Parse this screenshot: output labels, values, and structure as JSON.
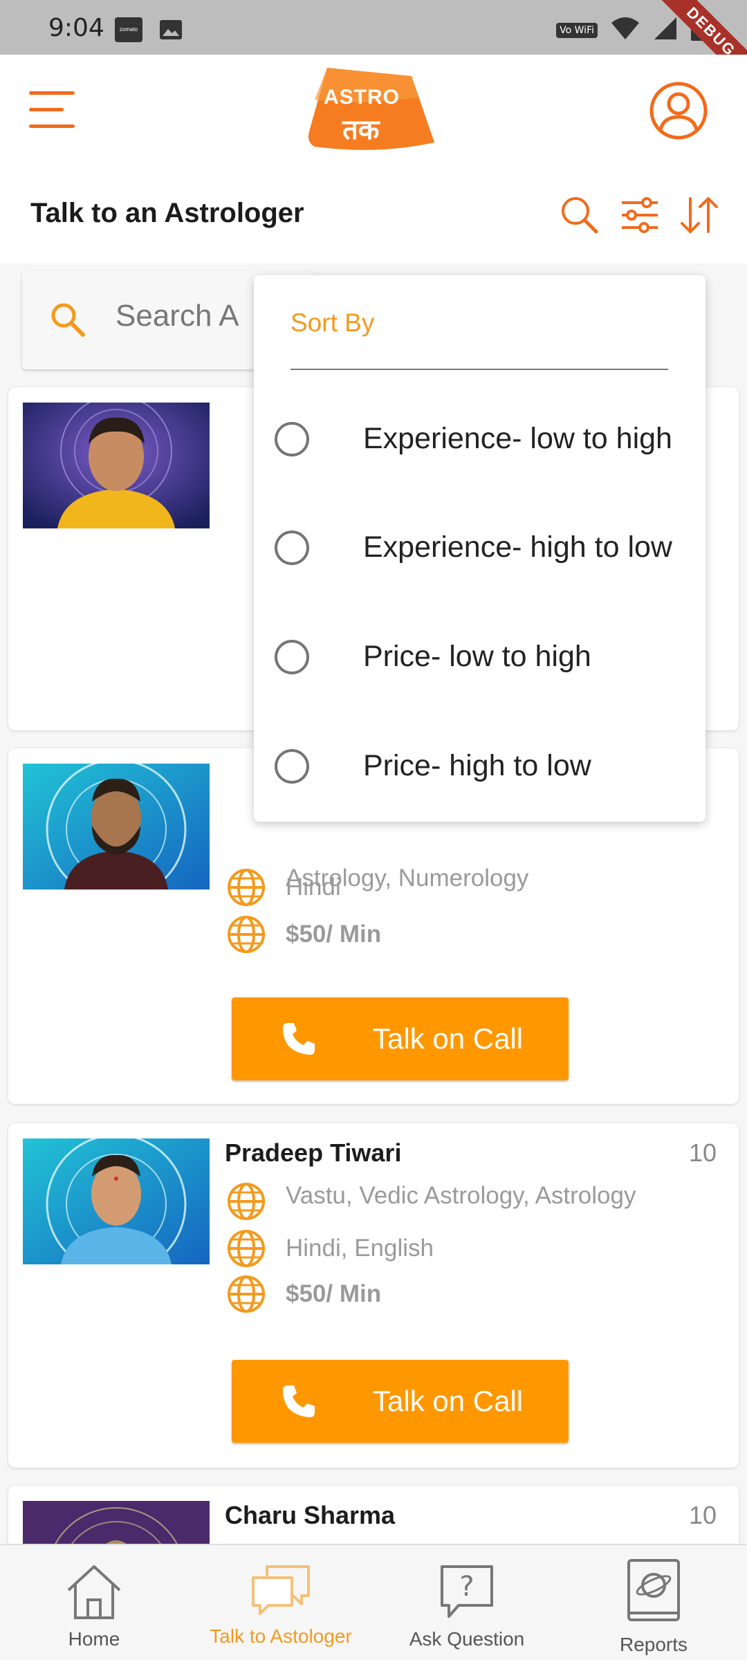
{
  "status_bar": {
    "time": "9:04",
    "app_icon_label": "zomato",
    "wifi_label": "Vo WiFi",
    "debug_label": "DEBUG"
  },
  "header": {
    "logo_line1": "ASTRO",
    "logo_line2": "तक",
    "page_title": "Talk to an Astrologer",
    "icons": [
      "menu-icon",
      "profile-icon",
      "search-icon",
      "filter-icon",
      "sort-icon"
    ]
  },
  "search": {
    "placeholder": "Search A"
  },
  "sort_menu": {
    "title": "Sort By",
    "options": [
      "Experience- low to high",
      "Experience- high to low",
      "Price- low to high",
      "Price- high to low"
    ]
  },
  "astrologers": [
    {
      "name": "",
      "experience": "",
      "skills": "",
      "languages": "",
      "price": ""
    },
    {
      "name": "",
      "experience": "",
      "skills": "Astrology, Numerology",
      "languages": "Hindi",
      "price": "$50/ Min",
      "call_label": "Talk on Call"
    },
    {
      "name": "Pradeep Tiwari",
      "experience": "10",
      "skills": "Vastu, Vedic Astrology, Astrology",
      "languages": "Hindi, English",
      "price": "$50/ Min",
      "call_label": "Talk on Call"
    },
    {
      "name": "Charu Sharma",
      "experience": "10"
    }
  ],
  "bottom_nav": {
    "items": [
      {
        "label": "Home",
        "icon": "home-icon"
      },
      {
        "label": "Talk to Astologer",
        "icon": "chat-icon"
      },
      {
        "label": "Ask Question",
        "icon": "question-icon"
      },
      {
        "label": "Reports",
        "icon": "report-book-icon"
      }
    ],
    "active_index": 1
  },
  "colors": {
    "accent": "#ff9800",
    "brand": "#f26a1b",
    "header_bg": "#ffffff",
    "page_bg": "#f6f6f6"
  }
}
